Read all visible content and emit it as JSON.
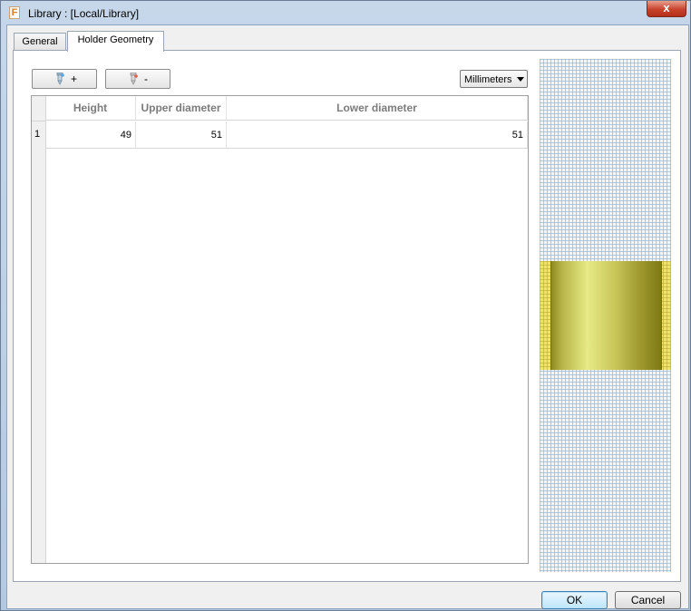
{
  "window": {
    "title": "Library : [Local/Library]",
    "app_icon_letter": "F",
    "close_glyph": "x"
  },
  "tabs": [
    {
      "label": "General",
      "active": false
    },
    {
      "label": "Holder Geometry",
      "active": true
    }
  ],
  "toolbar": {
    "add_label": "+",
    "add_icon": "add-holder-segment-icon",
    "remove_label": "-",
    "remove_icon": "remove-holder-segment-icon",
    "units_select": {
      "selected": "Millimeters"
    }
  },
  "table": {
    "columns": [
      "Height",
      "Upper diameter",
      "Lower diameter"
    ],
    "rows": [
      {
        "row_number": "1",
        "cells": [
          "49",
          "51",
          "51"
        ]
      }
    ]
  },
  "preview": {
    "background_color": "#eef6fb",
    "band_color": "#f0e36a",
    "holder_color": "#c9c65a"
  },
  "buttons": {
    "ok_label": "OK",
    "cancel_label": "Cancel"
  }
}
